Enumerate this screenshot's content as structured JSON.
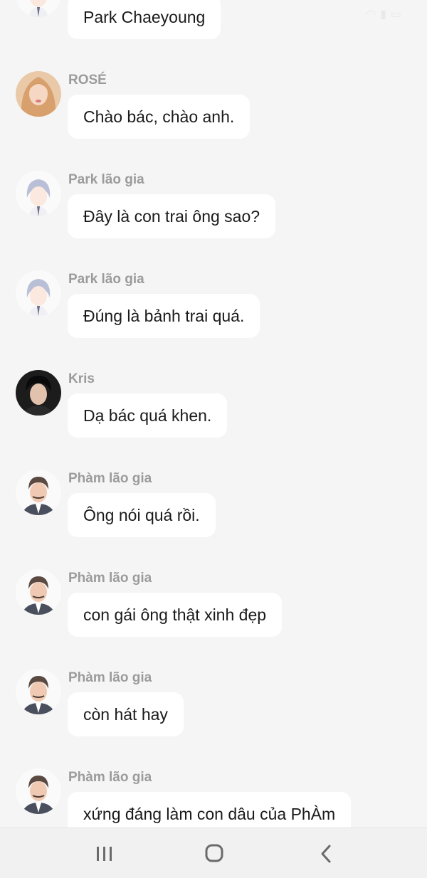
{
  "status_bar": {
    "icons": [
      "wifi-icon",
      "signal-icon",
      "battery-icon"
    ]
  },
  "messages": [
    {
      "sender": "",
      "text": "Park Chaeyoung",
      "avatar": "park-lao-gia-avatar"
    },
    {
      "sender": "ROSÉ",
      "text": "Chào bác, chào anh.",
      "avatar": "rose-avatar"
    },
    {
      "sender": "Park lão gia",
      "text": "Đây là con trai ông sao?",
      "avatar": "park-lao-gia-avatar"
    },
    {
      "sender": "Park lão gia",
      "text": "Đúng là bảnh trai quá.",
      "avatar": "park-lao-gia-avatar"
    },
    {
      "sender": "Kris",
      "text": "Dạ bác quá khen.",
      "avatar": "kris-avatar"
    },
    {
      "sender": "Phàm lão gia",
      "text": "Ông nói quá rồi.",
      "avatar": "pham-lao-gia-avatar"
    },
    {
      "sender": "Phàm lão gia",
      "text": "con gái ông thật xinh đẹp",
      "avatar": "pham-lao-gia-avatar"
    },
    {
      "sender": "Phàm lão gia",
      "text": "còn hát hay",
      "avatar": "pham-lao-gia-avatar"
    },
    {
      "sender": "Phàm lão gia",
      "text": "xứng đáng làm con dâu của PhÀm",
      "avatar": "pham-lao-gia-avatar"
    }
  ],
  "navbar": {
    "recent_icon": "recent-apps-icon",
    "home_icon": "home-icon",
    "back_icon": "back-icon"
  },
  "colors": {
    "background": "#f5f5f5",
    "bubble": "#ffffff",
    "sender_name": "#9b9b9b",
    "message_text": "#1a1a1a"
  }
}
